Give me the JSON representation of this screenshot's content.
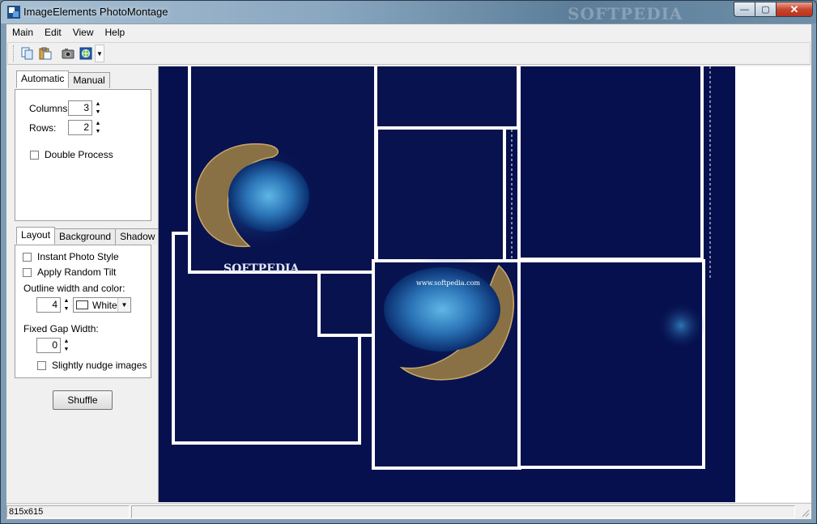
{
  "window": {
    "title": "ImageElements PhotoMontage",
    "watermark": "SOFTPEDIA",
    "minimize_label": "—",
    "maximize_label": "▢",
    "close_label": "✕"
  },
  "menu": {
    "items": [
      "Main",
      "Edit",
      "View",
      "Help"
    ]
  },
  "toolbar": {
    "icons": [
      "copy-icon",
      "paste-icon",
      "camera-icon",
      "web-icon"
    ],
    "dropdown_label": "▼"
  },
  "auto_tabs": {
    "tabs": [
      "Automatic",
      "Manual"
    ],
    "active": "Automatic",
    "columns_label": "Columns:",
    "columns_value": "3",
    "rows_label": "Rows:",
    "rows_value": "2",
    "double_process_label": "Double Process",
    "double_process_checked": false
  },
  "layout_tabs": {
    "tabs": [
      "Layout",
      "Background",
      "Shadow"
    ],
    "active": "Layout",
    "instant_photo_label": "Instant Photo Style",
    "random_tilt_label": "Apply Random Tilt",
    "outline_label": "Outline width and color:",
    "outline_width": "4",
    "outline_color_name": "White",
    "outline_color": "#ffffff",
    "gap_label": "Fixed Gap Width:",
    "gap_value": "0",
    "nudge_label": "Slightly nudge images"
  },
  "shuffle_label": "Shuffle",
  "spin_up": "▲",
  "spin_down": "▼",
  "select_arrow": "▼",
  "canvas": {
    "background_color": "#06104e",
    "frame_color": "#ffffff",
    "text_softpedia": "SOFTPEDIA",
    "text_url": "www.softpedia.com"
  },
  "status": {
    "dimensions": "815x615",
    "message": ""
  }
}
